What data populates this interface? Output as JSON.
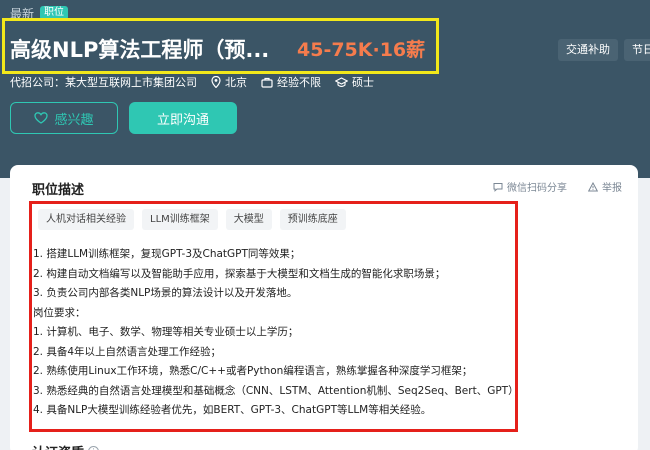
{
  "header": {
    "crumb": "最新",
    "badge": "职位",
    "title": "高级NLP算法工程师（预...",
    "salary": "45-75K·16薪",
    "tags": [
      "交通补助",
      "节日福"
    ],
    "recruiter": "代招公司：某大型互联网上市集团公司",
    "location": "北京",
    "experience": "经验不限",
    "education": "硕士",
    "like_label": "感兴趣",
    "chat_label": "立即沟通"
  },
  "section": {
    "title": "职位描述",
    "share_label": "微信扫码分享",
    "report_label": "举报",
    "chips": [
      "人机对话相关经验",
      "LLM训练框架",
      "大模型",
      "预训练底座"
    ],
    "lines": [
      "1. 搭建LLM训练框架，复现GPT-3及ChatGPT同等效果；",
      "2. 构建自动文档编写以及智能助手应用，探索基于大模型和文档生成的智能化求职场景；",
      "3. 负责公司内部各类NLP场景的算法设计以及开发落地。",
      "岗位要求：",
      "1. 计算机、电子、数学、物理等相关专业硕士以上学历；",
      "2. 具备4年以上自然语言处理工作经验；",
      "2. 熟练使用Linux工作环境，熟悉C/C++或者Python编程语言，熟练掌握各种深度学习框架；",
      "3. 熟悉经典的自然语言处理模型和基础概念（CNN、LSTM、Attention机制、Seq2Seq、Bert、GPT）；",
      "4. 具备NLP大模型训练经验者优先，如BERT、GPT-3、ChatGPT等LLM等相关经验。"
    ],
    "next_title": "认证资质"
  },
  "colors": {
    "header_bg": "#3b5566",
    "accent": "#2fc7b3",
    "salary": "#f57c4d",
    "highlight_yellow": "#f2e81b",
    "highlight_red": "#e5201a"
  }
}
